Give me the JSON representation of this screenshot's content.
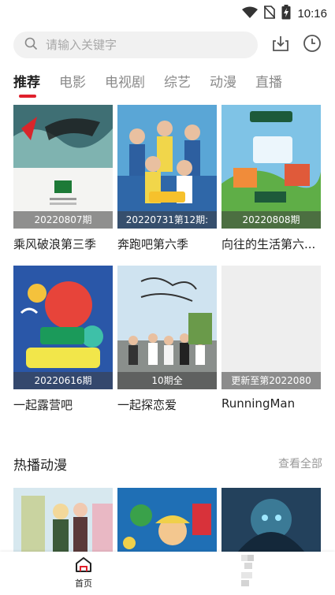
{
  "status_bar": {
    "time": "10:16"
  },
  "search": {
    "placeholder": "请输入关键字"
  },
  "tabs": [
    {
      "label": "推荐",
      "active": true
    },
    {
      "label": "电影",
      "active": false
    },
    {
      "label": "电视剧",
      "active": false
    },
    {
      "label": "综艺",
      "active": false
    },
    {
      "label": "动漫",
      "active": false
    },
    {
      "label": "直播",
      "active": false
    }
  ],
  "cards": [
    {
      "title": "乘风破浪第三季",
      "tag": "20220807期"
    },
    {
      "title": "奔跑吧第六季",
      "tag": "20220731第12期:"
    },
    {
      "title": "向往的生活第六...",
      "tag": "20220808期"
    },
    {
      "title": "一起露营吧",
      "tag": "20220616期"
    },
    {
      "title": "一起探恋爱",
      "tag": "10期全"
    },
    {
      "title": "RunningMan",
      "tag": "更新至第2022080"
    }
  ],
  "section": {
    "title": "热播动漫",
    "more": "查看全部"
  },
  "bottom_nav": {
    "home_label": "首页"
  },
  "colors": {
    "accent": "#e0202c",
    "tab_inactive": "#8a8a8a",
    "search_bg": "#f1f1f1"
  }
}
